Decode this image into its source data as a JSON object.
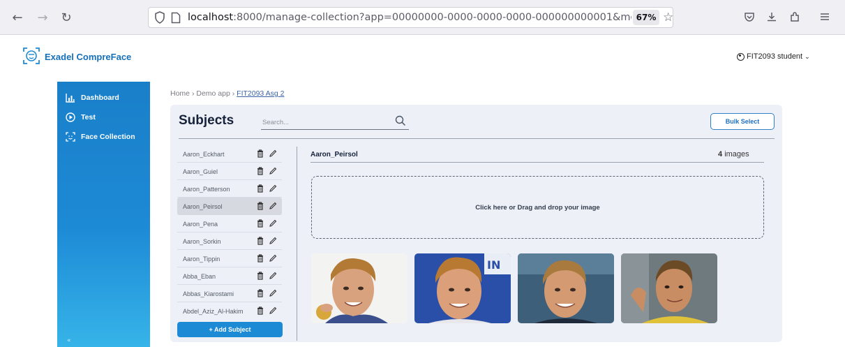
{
  "browser": {
    "back_icon": "back-arrow-icon",
    "url_host": "localhost",
    "url_rest": ":8000/manage-collection?app=00000000-0000-0000-0000-000000000001&mo",
    "zoom": "67%"
  },
  "header": {
    "logo_text": "Exadel CompreFace",
    "user_name": "FIT2093 student"
  },
  "sidebar": {
    "items": [
      {
        "label": "Dashboard",
        "icon": "dashboard-icon"
      },
      {
        "label": "Test",
        "icon": "play-icon"
      },
      {
        "label": "Face Collection",
        "icon": "face-icon"
      }
    ],
    "collapse_label": "«"
  },
  "breadcrumb": {
    "home": "Home",
    "sep1": "›",
    "app": "Demo app",
    "sep2": "›",
    "current": "FIT2093 Asg 2"
  },
  "subjects": {
    "title": "Subjects",
    "search_placeholder": "Search...",
    "bulk_select_label": "Bulk Select",
    "add_subject_label": "+ Add Subject",
    "list": [
      "Aaron_Eckhart",
      "Aaron_Guiel",
      "Aaron_Patterson",
      "Aaron_Peirsol",
      "Aaron_Pena",
      "Aaron_Sorkin",
      "Aaron_Tippin",
      "Abba_Eban",
      "Abbas_Kiarostami",
      "Abdel_Aziz_Al-Hakim"
    ],
    "selected": "Aaron_Peirsol"
  },
  "detail": {
    "name": "Aaron_Peirsol",
    "count": "4",
    "count_suffix": "images",
    "dropzone_text": "Click here or Drag and drop your image"
  },
  "colors": {
    "brand_blue": "#1d8ad6",
    "panel_bg": "#edf1f7",
    "title_dark": "#16213a"
  }
}
